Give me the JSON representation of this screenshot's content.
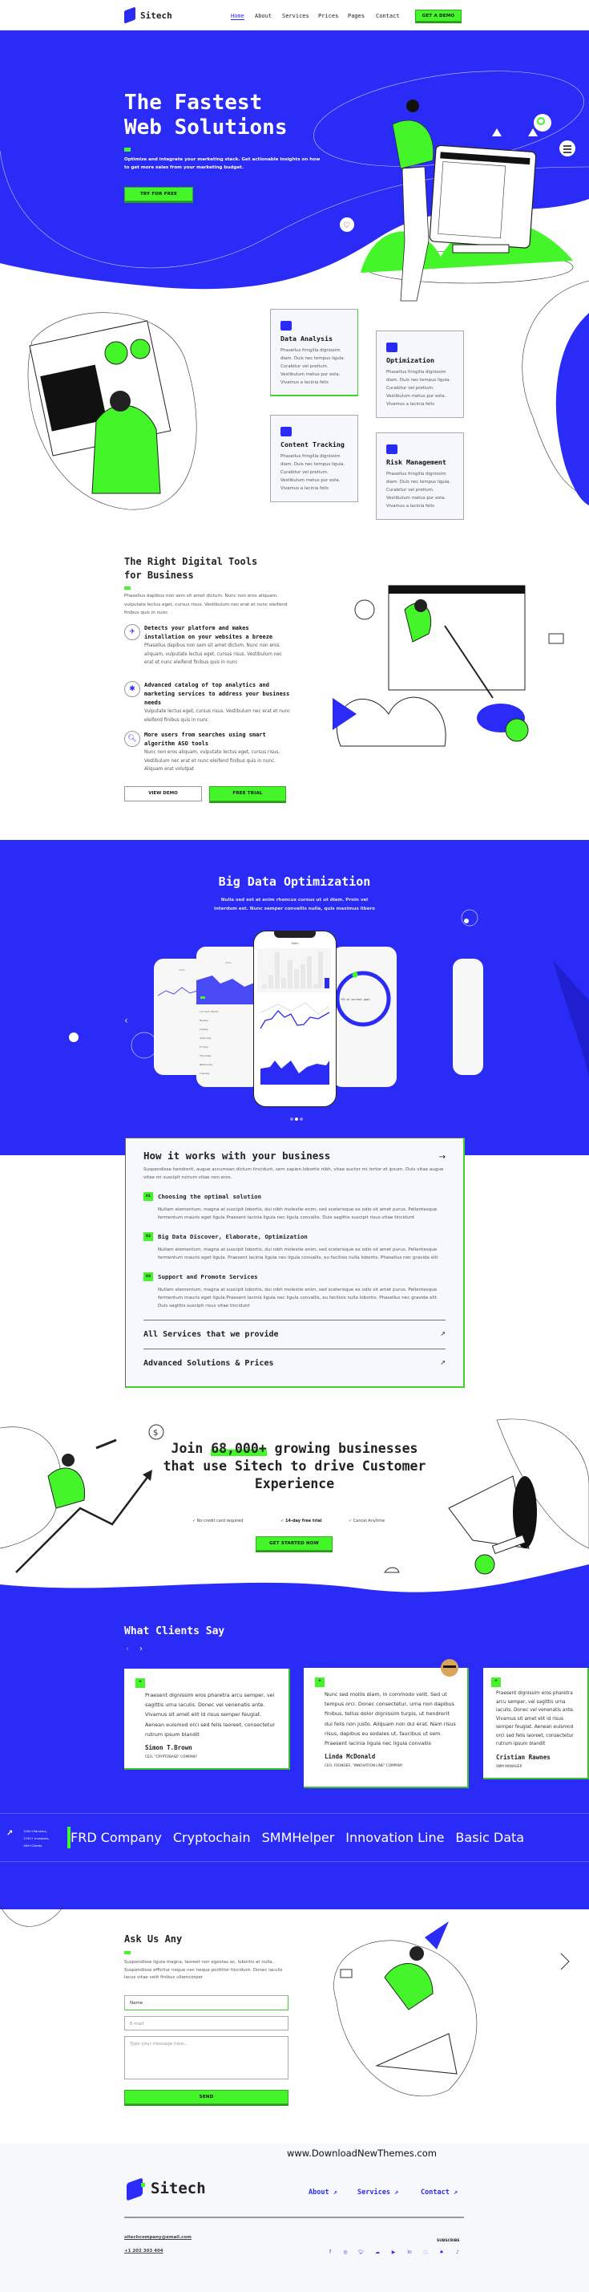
{
  "colors": {
    "brand_blue": "#2b2bf7",
    "accent_green": "#44f52a"
  },
  "header": {
    "logo": "Sitech",
    "nav": [
      "Home",
      "About",
      "Services",
      "Prices",
      "Pages",
      "Contact"
    ],
    "active": "Home",
    "cta": "GET A DEMO"
  },
  "hero": {
    "title_line1": "The Fastest",
    "title_line2": "Web Solutions",
    "subtitle_line1": "Optimize and integrate your marketing stack. Get actionable insights on how",
    "subtitle_line2": "to get more sales from your marketing budget.",
    "cta": "TRY FOR FREE"
  },
  "features": [
    {
      "icon": "chart-icon",
      "title": "Data Analysis",
      "text": "Phasellus fringilla dignissim diam. Duis nec tempus ligula. Curabitur vel pretium. Vestibulum metus pur esta. Vivamus a lacinia felis"
    },
    {
      "icon": "optimization-icon",
      "title": "Optimization",
      "text": "Phasellus fringilla dignissim diam. Duis nec tempus ligula. Curabitur vel pretium. Vestibulum metus pur esta. Vivamus a lacinia felis"
    },
    {
      "icon": "document-search-icon",
      "title": "Content Tracking",
      "text": "Phasellus fringilla dignissim diam. Duis nec tempus ligula. Curabitur vel pretium. Vestibulum metus pur esta. Vivamus a lacinia felis"
    },
    {
      "icon": "user-shield-icon",
      "title": "Risk Management",
      "text": "Phasellus fringilla dignissim diam. Duis nec tempus ligula. Curabitur vel pretium. Vestibulum metus pur esta. Vivamus a lacinia felis"
    }
  ],
  "tools": {
    "title_line1": "The Right Digital Tools",
    "title_line2": "for Business",
    "intro": "Phasellus dapibus non sem sit amet dictum. Nunc non eros aliquam, vulputate lectus eget, cursus risus. Vestibulum nec erat et nunc eleifend finibus quis in nunc",
    "items": [
      {
        "icon": "plugin-icon",
        "glyph": "✈",
        "title": "Detects your platform and makes installation on your websites a breeze",
        "text": "Phasellus dapibus non sem sit amet dictum. Nunc non eros aliquam, vulputate lectus eget, cursus risus. Vestibulum nec erat et nunc eleifend finibus quis in nunc"
      },
      {
        "icon": "asterisk-icon",
        "glyph": "✱",
        "title": "Advanced catalog of top analytics and marketing services to address your business needs",
        "text": "Vulputate lectus eget, cursus risus. Vestibulum nec erat et nunc eleifend finibus quis in nunc"
      },
      {
        "icon": "search-icon",
        "glyph": "🔍︎",
        "title": "More users from searches using smart algorithm ASO tools",
        "text": "Nunc non eros aliquam, vulputate lectus eget, cursus risus. Vestibulum nec erat et nunc eleifend finibus quis in nunc. Aliquam erat volutpat"
      }
    ],
    "btn_demo": "VIEW DEMO",
    "btn_trial": "FREE TRIAL"
  },
  "bigdata": {
    "title": "Big Data Optimization",
    "subtitle_line1": "Nulla sed est at enim rhoncus cursus ut ut diam. Proin vel",
    "subtitle_line2": "interdum est. Nunc semper convallis nulla, quis maximus libero",
    "phone_header": "Stats",
    "goal_text": "75% of current goal.",
    "current_month": "Current Month",
    "days": [
      "Monday",
      "Sunday",
      "Saturday",
      "Friday",
      "Thursday",
      "Wednesday",
      "Tuesday"
    ],
    "active_slide": 2,
    "slides": 3
  },
  "how": {
    "title": "How it works with your business",
    "intro": "Suspendisse hendrerit, augue accumsan dictum tincidunt, sem sapien lobortis nibh, vitae auctor mi tortor et ipsum. Duis vitae augue vitae mi suscipit rutrum vitae non eros.",
    "steps": [
      {
        "num": "01",
        "title": "Choosing the optimal solution",
        "text": "Nullam elementum, magna at suscipit lobortis, dui nibh molestie enim, sed scelerisque ex odio sit amet purus. Pellentesque fermentum mauris eget ligula Praesent lacinia ligula nec ligula convallis. Duis sagittis suscipit risus vitae tincidunt"
      },
      {
        "num": "02",
        "title": "Big Data Discover, Elaborate, Optimization",
        "text": "Nullam elementum, magna at suscipit lobortis, dui nibh molestie enim, sed scelerisque ex odio sit amet purus. Pellentesque fermentum mauris eget ligula. Praesent lacinia ligula nec ligula convallis, eu facilisis nulla lobortis. Phasellus nec gravida elit"
      },
      {
        "num": "03",
        "title": "Support and Promote Services",
        "text": "Nullam elementum, magna at suscipit lobortis, dui nibh molestie enim, sed scelerisque ex odio sit amet purus. Pellentesque fermentum mauris eget ligula.Praesent lacinia ligula nec ligula convallis, eu facilisis nulla lobortis. Phasellus nec gravida elit. Duis sagittis suscipit risus vitae tincidunt"
      }
    ],
    "links": [
      "All Services that we provide",
      "Advanced Solutions & Prices"
    ]
  },
  "join": {
    "pre": "Join ",
    "highlight": "68,000+",
    "post": " growing businesses that use Sitech to drive Customer Experience",
    "checks": [
      "No credit card required",
      "14-day free trial",
      "Cancel Anytime"
    ],
    "cta": "GET STARTED NOW"
  },
  "clients": {
    "title": "What Clients Say",
    "testimonials": [
      {
        "text": "Praesent dignissim eros pharetra arcu semper, vel sagittis urna iaculis. Donec vel venenatis ante. Vivamus sit amet elit id risus semper feugiat. Aenean euismod orci sed felis laoreet, consectetur rutrum ipsum blandit",
        "name": "Simon T.Brown",
        "role": "CEO, \"CRYPTOBASE\" COMPANY"
      },
      {
        "text": "Nunc sed mollis diam, in commodo velit. Sed ut tempus orci. Donec consectetur, urna non dapibus finibus, tellus dolor dignissim turpis, ut hendrerit dui felis non justo. Aliquam non dui erat. Nam risus risus, dapibus eu sodales ut, faucibus ut sem. Praesent lacinia ligula nec ligula convallis",
        "name": "Linda McDonald",
        "role": "CEO, FOUNDER, \"INNOVATION LINE\" COMPANY"
      },
      {
        "text": "Praesent dignissim eros pharetra arcu semper, vel sagittis urna iaculis. Donec vel venenatis ante. Vivamus sit amet elit id risus semper feugiat. Aenean euismod orci sed felis laoreet, consectetur rutrum ipsum blandit",
        "name": "Cristian Rawnes",
        "role": "SMM MANAGER"
      }
    ]
  },
  "partners": {
    "stats": [
      "1000+Parnters,",
      "1700+ Investors,",
      "160+Clients"
    ],
    "logos": [
      "FRD Company",
      "Cryptochain",
      "SMMHelper",
      "Innovation Line",
      "Basic Data"
    ]
  },
  "contact": {
    "title": "Ask Us Any",
    "text": "Suspendisse ligula magna, laoreet non egestas ac, lobortis at nulla. Suspendisse efficitur neque nec neque porttitor tincidunt. Donec iaculis lacus vitae velit finibus ullamcorper",
    "name_value": "Name",
    "email_placeholder": "E-mail",
    "message_placeholder": "Type your message here...",
    "send": "SEND"
  },
  "watermark": "www.DownloadNewThemes.com",
  "footer": {
    "logo": "Sitech",
    "links": [
      "About",
      "Services",
      "Contact"
    ],
    "email": "sitechcompany@email.com",
    "phone": "+1 202 303 404",
    "subscribe": "SUBSCRIBE",
    "social": [
      "facebook-icon",
      "instagram-icon",
      "twitter-icon",
      "soundcloud-icon",
      "youtube-icon",
      "linkedin-icon",
      "whatsapp-icon",
      "snapchat-icon",
      "tiktok-icon"
    ],
    "social_glyphs": [
      "f",
      "◎",
      "🐦︎",
      "☁",
      "▶",
      "in",
      "◌",
      "♠",
      "♪"
    ]
  }
}
